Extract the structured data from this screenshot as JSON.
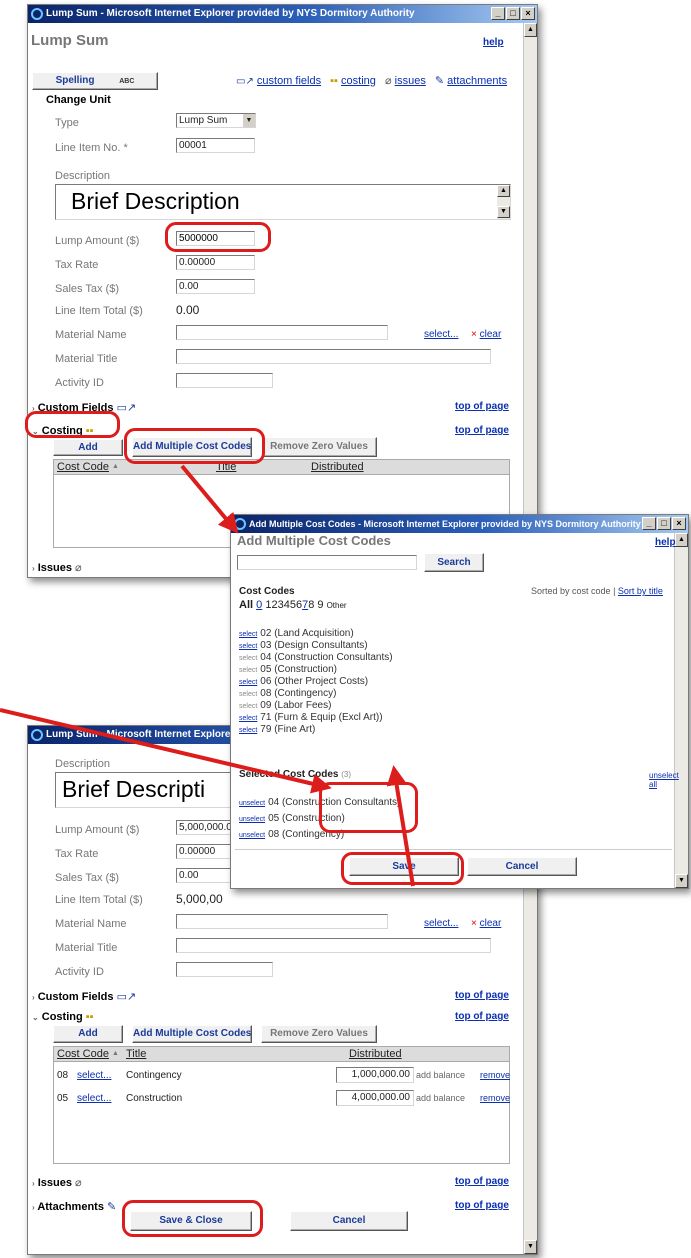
{
  "win1": {
    "title": "Lump Sum - Microsoft Internet Explorer provided by NYS Dormitory Authority",
    "page_title": "Lump Sum",
    "help": "help",
    "spelling": "Spelling",
    "spell_badge": "ABC",
    "toolbar": {
      "custom_fields": "custom fields",
      "costing": "costing",
      "issues": "issues",
      "attachments": "attachments"
    },
    "section_change_unit": "Change Unit",
    "labels": {
      "type": "Type",
      "line_item_no": "Line Item No. *",
      "description": "Description",
      "lump_amount": "Lump Amount ($)",
      "tax_rate": "Tax Rate",
      "sales_tax": "Sales Tax ($)",
      "line_item_total": "Line Item Total ($)",
      "material_name": "Material Name",
      "material_title": "Material Title",
      "activity_id": "Activity ID"
    },
    "values": {
      "type": "Lump Sum",
      "line_item_no": "00001",
      "description": "Brief Description",
      "lump_amount": "5000000",
      "tax_rate": "0.00000",
      "sales_tax": "0.00",
      "line_item_total": "0.00"
    },
    "select_link": "select...",
    "clear_link": "clear",
    "custom_fields": "Custom Fields",
    "costing": "Costing",
    "top_of_page": "top of page",
    "btn_add": "Add",
    "btn_add_multiple": "Add Multiple Cost Codes",
    "btn_remove_zero": "Remove Zero Values",
    "col_cost_code": "Cost Code",
    "col_title": "Title",
    "col_distributed": "Distributed",
    "issues": "Issues"
  },
  "win2": {
    "title": "Add Multiple Cost Codes - Microsoft Internet Explorer provided by NYS Dormitory Authority",
    "page_title": "Add Multiple Cost Codes",
    "help": "help",
    "search_btn": "Search",
    "cost_codes_heading": "Cost Codes",
    "sorted_by": "Sorted by cost code",
    "sep": "|",
    "sort_by_title": "Sort by title",
    "filter_all": "All",
    "filter_digits": [
      "0",
      "1",
      "2",
      "3",
      "4",
      "5",
      "6",
      "7",
      "8",
      "9"
    ],
    "filter_other": "Other",
    "codes": [
      {
        "sel": "select",
        "label": "02 (Land Acquisition)",
        "link": true
      },
      {
        "sel": "select",
        "label": "03 (Design Consultants)",
        "link": true
      },
      {
        "sel": "select",
        "label": "04 (Construction Consultants)",
        "link": false
      },
      {
        "sel": "select",
        "label": "05 (Construction)",
        "link": false
      },
      {
        "sel": "select",
        "label": "06 (Other Project Costs)",
        "link": true
      },
      {
        "sel": "select",
        "label": "08 (Contingency)",
        "link": false
      },
      {
        "sel": "select",
        "label": "09 (Labor Fees)",
        "link": false
      },
      {
        "sel": "select",
        "label": "71 (Furn & Equip (Excl Art))",
        "link": true
      },
      {
        "sel": "select",
        "label": "79 (Fine Art)",
        "link": true
      }
    ],
    "selected_heading": "Selected Cost Codes",
    "selected_count": "(3)",
    "unselect_all": "unselect all",
    "selected": [
      {
        "sel": "unselect",
        "label": "04 (Construction Consultants)"
      },
      {
        "sel": "unselect",
        "label": "05 (Construction)"
      },
      {
        "sel": "unselect",
        "label": "08 (Contingency)"
      }
    ],
    "save": "Save",
    "cancel": "Cancel"
  },
  "win3": {
    "title": "Lump Sum - Microsoft Internet Explorer provided by NYS Dormitory Authority",
    "title_visible": "Lump Sum - Microsoft Internet Explorer pro",
    "labels": {
      "description": "Description",
      "lump_amount": "Lump Amount ($)",
      "tax_rate": "Tax Rate",
      "sales_tax": "Sales Tax ($)",
      "line_item_total": "Line Item Total ($)",
      "material_name": "Material Name",
      "material_title": "Material Title",
      "activity_id": "Activity ID"
    },
    "values": {
      "description": "Brief Descripti",
      "lump_amount": "5,000,000.0",
      "tax_rate": "0.00000",
      "sales_tax": "0.00",
      "line_item_total": "5,000,00"
    },
    "select_link": "select...",
    "clear_link": "clear",
    "custom_fields": "Custom Fields",
    "costing": "Costing",
    "top_of_page": "top of page",
    "btn_add": "Add",
    "btn_add_multiple": "Add Multiple Cost Codes",
    "btn_remove_zero": "Remove Zero Values",
    "col_cost_code": "Cost Code",
    "col_title": "Title",
    "col_distributed": "Distributed",
    "rows": [
      {
        "code": "08",
        "select": "select...",
        "title": "Contingency",
        "distributed": "1,000,000.00",
        "add_balance": "add balance",
        "remove": "remove"
      },
      {
        "code": "05",
        "select": "select...",
        "title": "Construction",
        "distributed": "4,000,000.00",
        "add_balance": "add balance",
        "remove": "remove"
      }
    ],
    "issues": "Issues",
    "attachments": "Attachments",
    "save_close": "Save & Close",
    "cancel": "Cancel"
  },
  "colors": {
    "accent_red": "#dd1c1c",
    "link_blue": "#0a2fb0",
    "titlebar": "#0a246a"
  }
}
